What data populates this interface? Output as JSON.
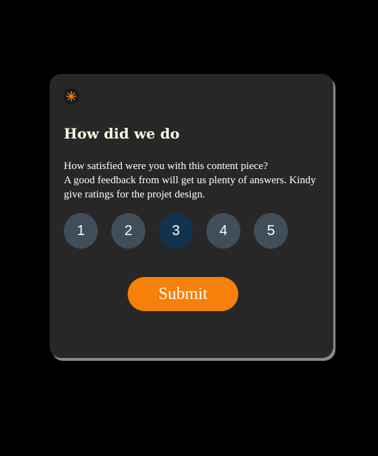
{
  "card": {
    "icon": "star-icon",
    "title": "How did we do",
    "description_lines": [
      "How satisfied were you with this content piece?",
      "A good feedback from will get us plenty of answers. Kindy give ratings for the projet design."
    ],
    "ratings": [
      {
        "label": "1"
      },
      {
        "label": "2"
      },
      {
        "label": "3"
      },
      {
        "label": "4"
      },
      {
        "label": "5"
      }
    ],
    "selected_rating": "3",
    "submit_label": "Submit"
  },
  "colors": {
    "background": "#000000",
    "card": "#282727",
    "rating": "#404e59",
    "rating_selected": "#113350",
    "accent": "#f6810a"
  }
}
